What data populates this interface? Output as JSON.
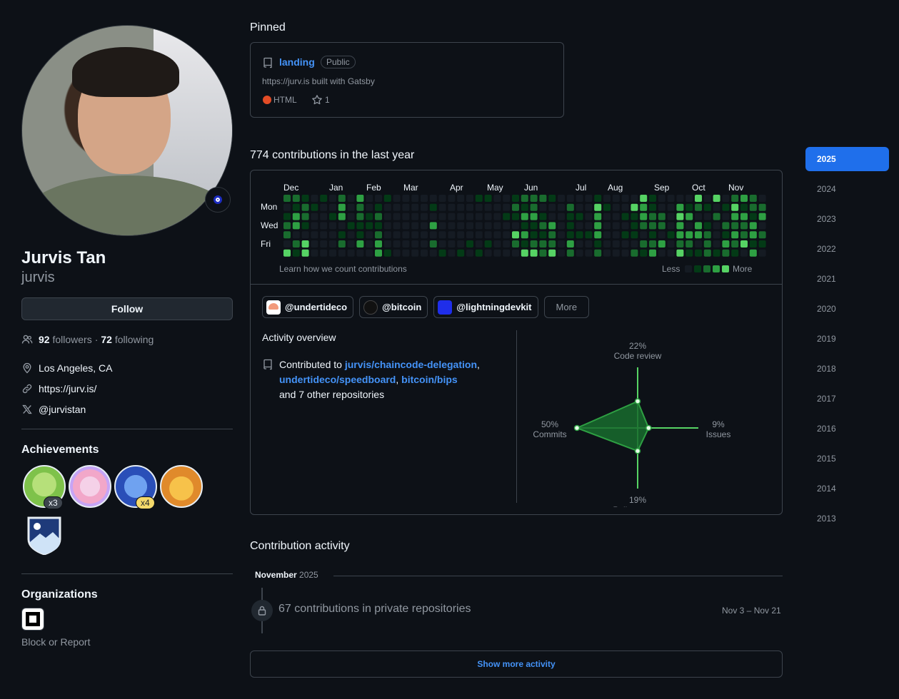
{
  "profile": {
    "name": "Jurvis Tan",
    "login": "jurvis",
    "follow_label": "Follow",
    "followers_count": "92",
    "followers_label": "followers",
    "separator": "·",
    "following_count": "72",
    "following_label": "following",
    "location": "Los Angeles, CA",
    "website": "https://jurv.is/",
    "twitter": "@jurvistan"
  },
  "achievements": {
    "title": "Achievements",
    "badges": [
      {
        "name": "pair-extraordinaire",
        "count": "x3"
      },
      {
        "name": "yolo",
        "count": ""
      },
      {
        "name": "pull-shark",
        "count": "x4"
      },
      {
        "name": "quickdraw",
        "count": ""
      },
      {
        "name": "arctic-code-vault",
        "count": ""
      }
    ]
  },
  "organizations": {
    "title": "Organizations",
    "block_label": "Block or Report"
  },
  "pinned": {
    "title": "Pinned",
    "repo": {
      "name": "landing",
      "visibility": "Public",
      "description": "https://jurv.is built with Gatsby",
      "language": "HTML",
      "language_color": "#e34c26",
      "stars": "1"
    }
  },
  "contributions": {
    "title": "774 contributions in the last year",
    "months": [
      "Dec",
      "Jan",
      "Feb",
      "Mar",
      "Apr",
      "May",
      "Jun",
      "Jul",
      "Aug",
      "Sep",
      "Oct",
      "Nov"
    ],
    "days": [
      "Mon",
      "Wed",
      "Fri"
    ],
    "learn_label": "Learn how we count contributions",
    "less_label": "Less",
    "more_label": "More",
    "levels": [
      "#151b23",
      "#033a16",
      "#196c2e",
      "#2ea043",
      "#56d364"
    ]
  },
  "orgs_filter": [
    {
      "label": "@undertideco",
      "color": "#f2a38a"
    },
    {
      "label": "@bitcoin",
      "color": "#1a1a1a"
    },
    {
      "label": "@lightningdevkit",
      "color": "#1f2eea"
    }
  ],
  "more_button": "More",
  "activity_overview": {
    "title": "Activity overview",
    "contributed_prefix": "Contributed to",
    "repo1": "jurvis/chaincode-delegation",
    "repo2": "undertideco/speedboard",
    "repo3": "bitcoin/bips",
    "other": "and 7 other repositories",
    "comma": ","
  },
  "chart_data": {
    "type": "radar",
    "axes": [
      "Code review",
      "Issues",
      "Pull requests",
      "Commits"
    ],
    "values": [
      22,
      9,
      19,
      50
    ],
    "labels": [
      "22%",
      "9%",
      "19%",
      "50%"
    ]
  },
  "contribution_activity": {
    "title": "Contribution activity",
    "month": "November",
    "year": "2025",
    "item": "67 contributions in private repositories",
    "range": "Nov 3 – Nov 21",
    "show_more": "Show more activity"
  },
  "years": [
    "2025",
    "2024",
    "2023",
    "2022",
    "2021",
    "2020",
    "2019",
    "2018",
    "2017",
    "2016",
    "2015",
    "2014",
    "2013"
  ],
  "colors": {
    "accent": "#1f6feb",
    "link": "#4493f8",
    "graph_green": "#56d364"
  }
}
